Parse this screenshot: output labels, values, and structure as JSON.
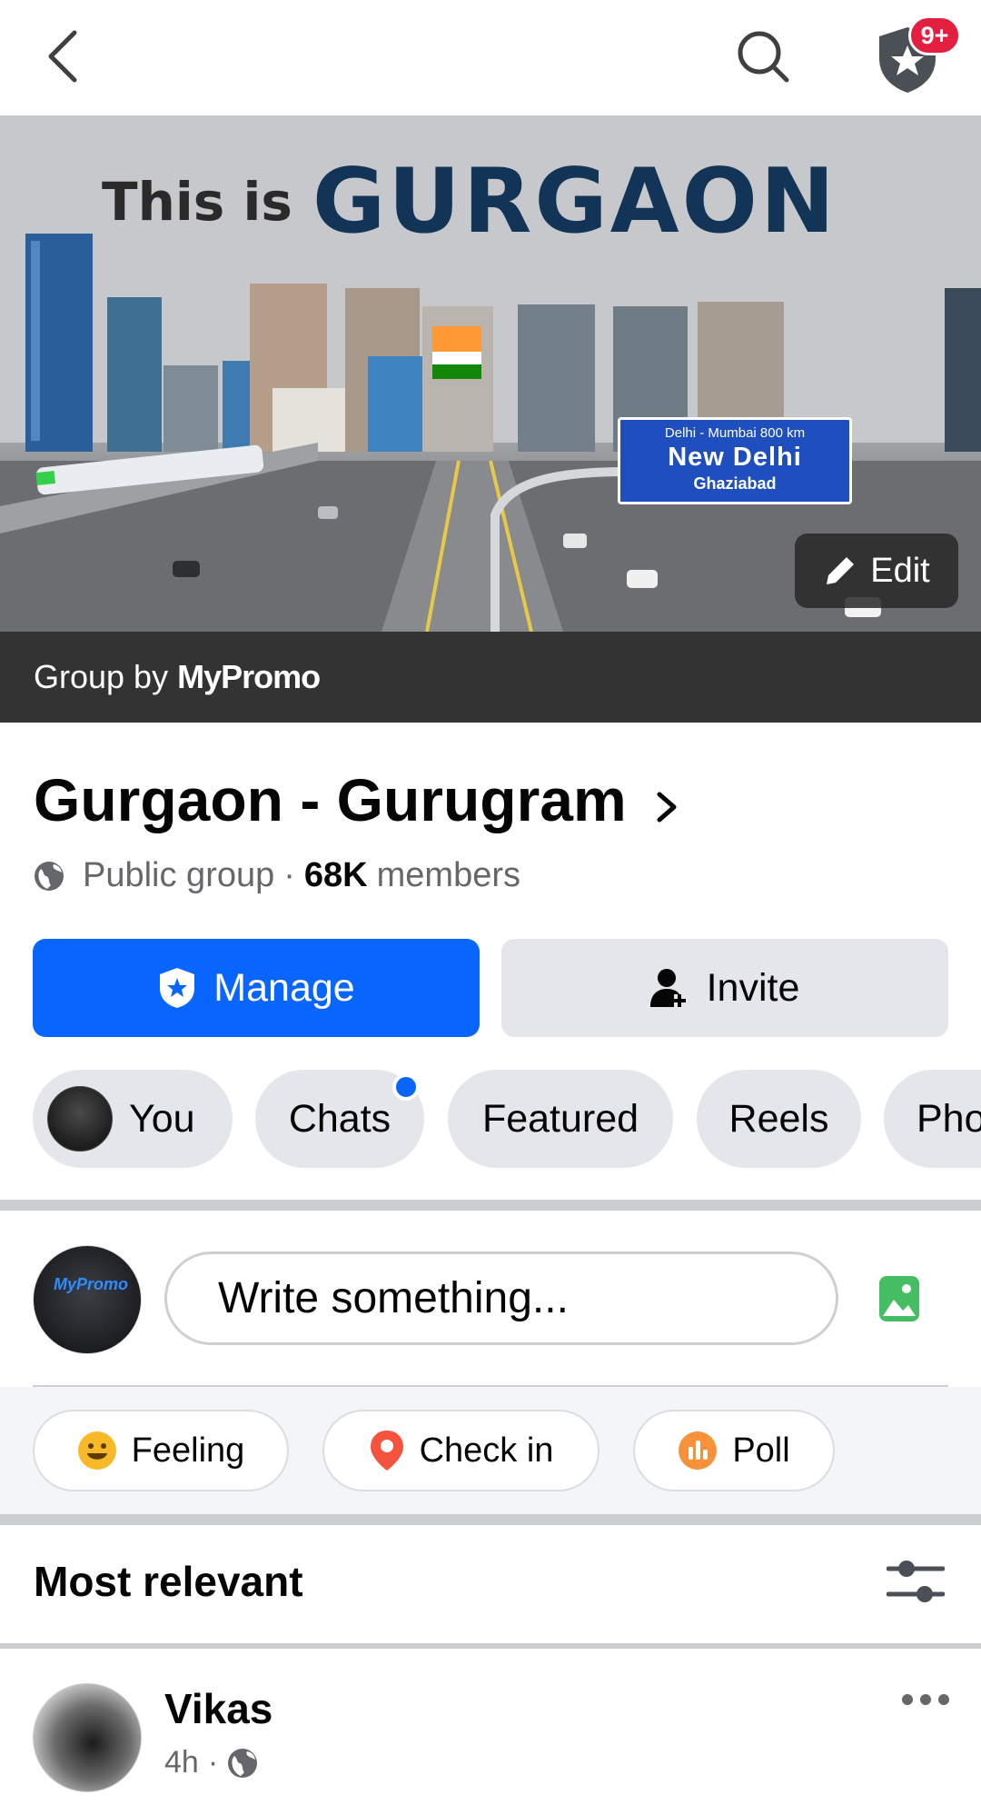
{
  "topbar": {
    "back_icon": "chevron-left-icon",
    "search_icon": "search-icon",
    "badge": "9+"
  },
  "cover": {
    "title_prefix": "This is",
    "title_main": "GURGAON",
    "sign_top": "Delhi - Mumbai 800 km",
    "sign_main": "New Delhi",
    "sign_bottom": "Ghaziabad",
    "edit_label": "Edit"
  },
  "group_by": {
    "prefix": "Group by",
    "owner": "MyPromo"
  },
  "group": {
    "name": "Gurgaon - Gurugram",
    "privacy": "Public group",
    "separator": "·",
    "members_count": "68K",
    "members_label": "members"
  },
  "buttons": {
    "manage": "Manage",
    "invite": "Invite"
  },
  "tabs": [
    {
      "label": "You"
    },
    {
      "label": "Chats"
    },
    {
      "label": "Featured"
    },
    {
      "label": "Reels"
    },
    {
      "label": "Pho"
    }
  ],
  "composer": {
    "avatar_text": "MyPromo",
    "placeholder": "Write something..."
  },
  "actions": {
    "feeling": "Feeling",
    "checkin": "Check in",
    "poll": "Poll"
  },
  "sort": {
    "label": "Most relevant"
  },
  "post": {
    "author": "Vikas",
    "time": "4h",
    "separator": "·"
  },
  "colors": {
    "primary": "#0866ff",
    "badge": "#e41e3f",
    "secondary_bg": "#e4e6eb"
  }
}
